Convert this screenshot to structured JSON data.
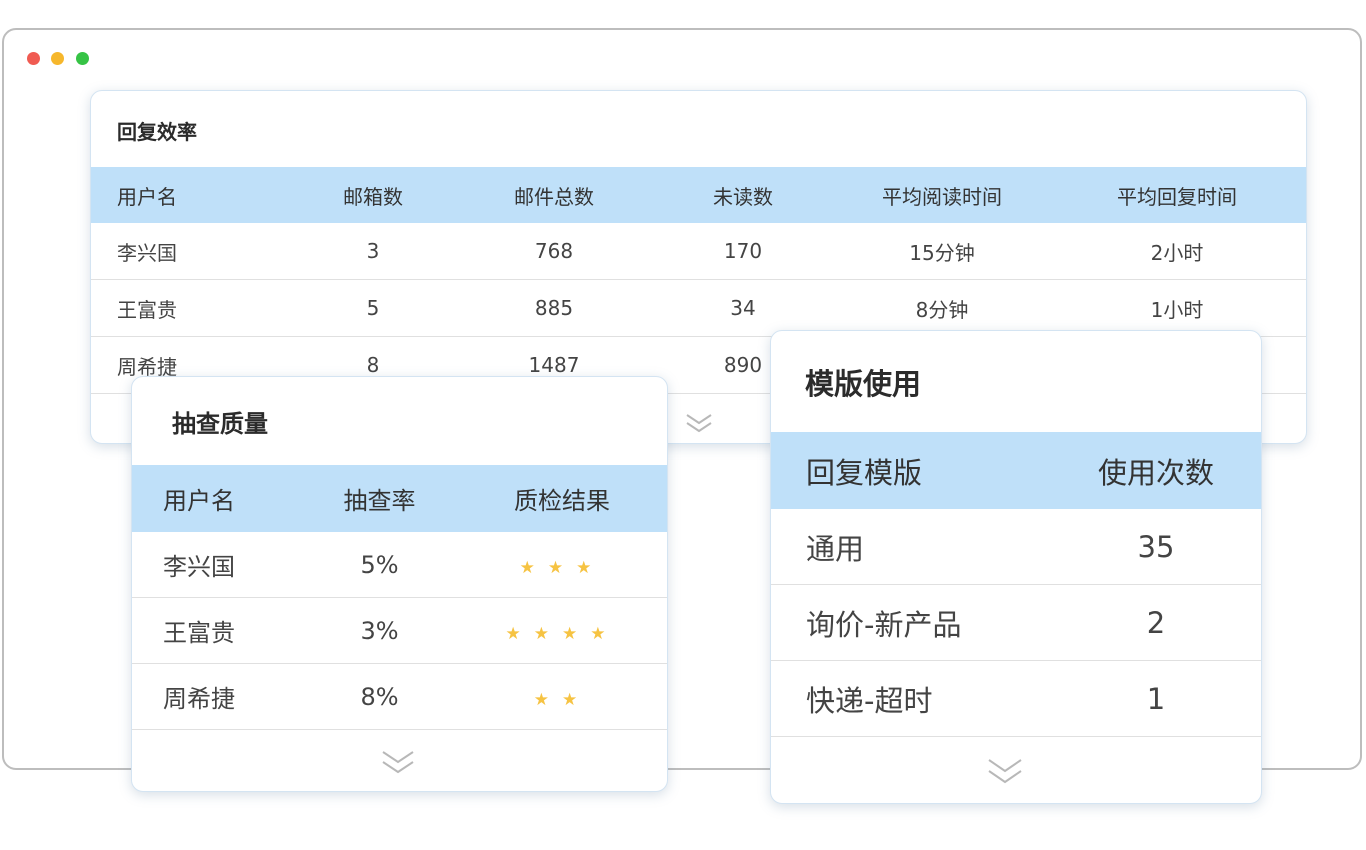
{
  "window": {
    "controls": {
      "close_color": "#f05b52",
      "minimize_color": "#f6b72c",
      "maximize_color": "#36c345"
    }
  },
  "colors": {
    "header_bg": "#bfe0f9",
    "star": "#f6c342",
    "chevron": "#b8b8b8"
  },
  "efficiency": {
    "title": "回复效率",
    "columns": [
      "用户名",
      "邮箱数",
      "邮件总数",
      "未读数",
      "平均阅读时间",
      "平均回复时间"
    ],
    "rows": [
      [
        "李兴国",
        "3",
        "768",
        "170",
        "15分钟",
        "2小时"
      ],
      [
        "王富贵",
        "5",
        "885",
        "34",
        "8分钟",
        "1小时"
      ],
      [
        "周希捷",
        "8",
        "1487",
        "890",
        "",
        ""
      ]
    ],
    "expand_icon": "chevron-double-down-icon"
  },
  "quality": {
    "title": "抽查质量",
    "columns": [
      "用户名",
      "抽查率",
      "质检结果"
    ],
    "rows": [
      {
        "name": "李兴国",
        "rate": "5%",
        "stars": 3
      },
      {
        "name": "王富贵",
        "rate": "3%",
        "stars": 4
      },
      {
        "name": "周希捷",
        "rate": "8%",
        "stars": 2
      }
    ],
    "expand_icon": "chevron-double-down-icon"
  },
  "template": {
    "title": "模版使用",
    "columns": [
      "回复模版",
      "使用次数"
    ],
    "rows": [
      [
        "通用",
        "35"
      ],
      [
        "询价-新产品",
        "2"
      ],
      [
        "快递-超时",
        "1"
      ]
    ],
    "expand_icon": "chevron-double-down-icon"
  }
}
